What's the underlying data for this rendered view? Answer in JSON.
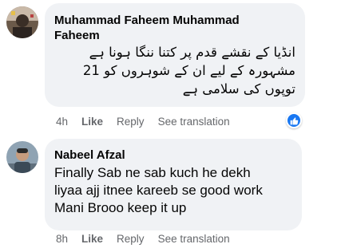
{
  "comments": [
    {
      "author": "Muhammad Faheem Muhammad Faheem",
      "author_line1": "Muhammad Faheem Muhammad",
      "author_line2": "Faheem",
      "text_lines": [
        "انڈیا کے نقشے قدم پر کتنا ننگا ہونا ہے",
        "مشہورہ کے لیے ان کے شوہروں کو 21",
        "توپوں کی سلامی ہے"
      ],
      "time": "4h",
      "like_label": "Like",
      "reply_label": "Reply",
      "translate_label": "See translation",
      "has_reaction": true,
      "reaction_icon": "thumbs-up-icon",
      "accent": "#1877f2"
    },
    {
      "author": "Nabeel Afzal",
      "text_lines": [
        "Finally Sab ne sab kuch he dekh",
        "liyaa ajj itnee kareeb se good work",
        "Mani Brooo keep it up"
      ],
      "time": "8h",
      "like_label": "Like",
      "reply_label": "Reply",
      "translate_label": "See translation"
    }
  ]
}
